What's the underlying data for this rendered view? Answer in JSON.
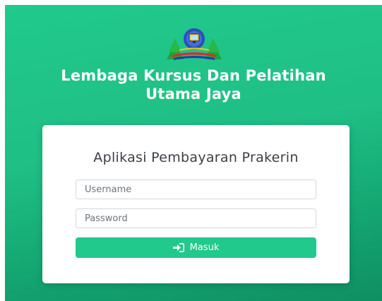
{
  "header": {
    "org_name_line1": "Lembaga Kursus Dan Pelatihan",
    "org_name_line2": "Utama Jaya",
    "logo_icon": "computer-book-landscape-logo"
  },
  "login_card": {
    "app_title": "Aplikasi Pembayaran Prakerin",
    "username_placeholder": "Username",
    "username_value": "",
    "password_placeholder": "Password",
    "password_value": "",
    "submit_label": "Masuk",
    "submit_icon": "sign-in-icon"
  },
  "colors": {
    "background_gradient_start": "#21c98c",
    "background_gradient_end": "#0f8f62",
    "accent": "#21c98c",
    "card": "#ffffff",
    "title_text": "#3b3f45"
  }
}
